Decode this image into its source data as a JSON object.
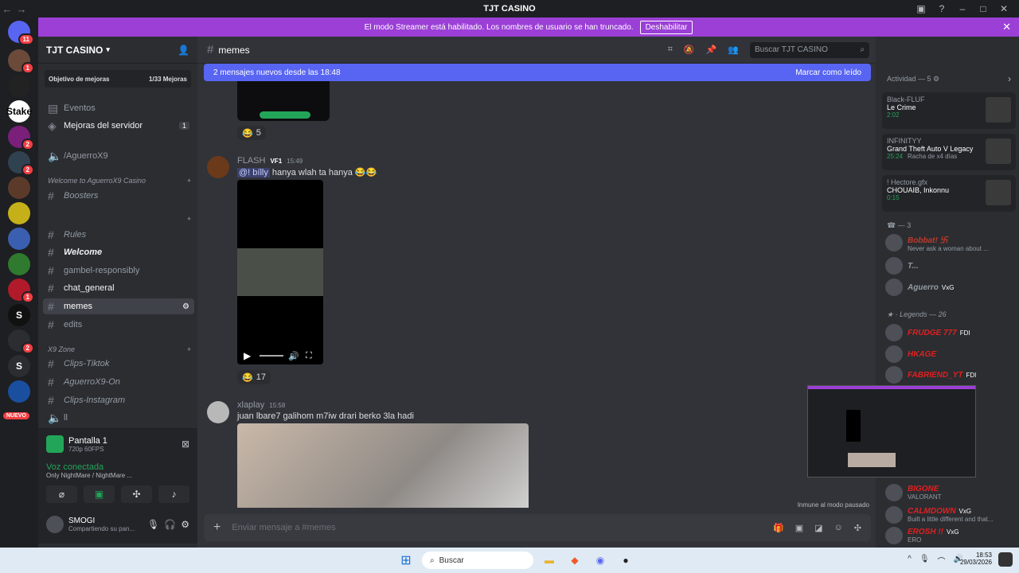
{
  "titlebar": {
    "title": "TJT CASINO"
  },
  "banner": {
    "text": "El modo Streamer está habilitado. Los nombres de usuario se han truncado.",
    "button": "Deshabilitar"
  },
  "guilds": [
    {
      "label": "",
      "badge": "11",
      "color": "#5865f2"
    },
    {
      "label": "",
      "badge": "1",
      "color": "#6b4a3a"
    },
    {
      "label": "",
      "badge": "",
      "color": "#222"
    },
    {
      "label": "Stake",
      "badge": "",
      "color": "#fff"
    },
    {
      "label": "",
      "badge": "2",
      "color": "#7a1f7a"
    },
    {
      "label": "",
      "badge": "2",
      "color": "#30414f"
    },
    {
      "label": "",
      "badge": "",
      "color": "#5b3a2a"
    },
    {
      "label": "",
      "badge": "",
      "color": "#c5b01a"
    },
    {
      "label": "",
      "badge": "",
      "color": "#3a5fb0"
    },
    {
      "label": "",
      "badge": "",
      "color": "#2f7a2f"
    },
    {
      "label": "",
      "badge": "1",
      "color": "#b01a2a"
    },
    {
      "label": "S",
      "badge": "",
      "color": "#111"
    },
    {
      "label": "",
      "badge": "2",
      "color": "#2b2d31"
    },
    {
      "label": "S",
      "badge": "",
      "color": "#2b2d31"
    },
    {
      "label": "",
      "badge": "",
      "color": "#1a4fa0"
    }
  ],
  "guild_new_label": "NUEVO",
  "server": {
    "name": "TJT CASINO",
    "boost_label": "Objetivo de mejoras",
    "boost_progress": "1/33 Mejoras"
  },
  "sidebar": {
    "events": "Eventos",
    "server_boosts": "Mejoras del servidor",
    "server_boosts_count": "1",
    "voice1": "/AguerroX9",
    "cat1": "Welcome to AguerroX9 Casino",
    "boosters": "Boosters",
    "cat2": "",
    "rules": "Rules",
    "welcome": "Welcome",
    "gambel": "gambel-responsibly",
    "chat_general": "chat_general",
    "memes": "memes",
    "edits": "edits",
    "cat3": "X9 Zone",
    "tiktok": "Clips-Tiktok",
    "aguerro_on": "AguerroX9-On",
    "instagram": "Clips-Instagram",
    "voice2": "ll"
  },
  "stream": {
    "title": "Pantalla 1",
    "quality": "720p 60FPS"
  },
  "voice": {
    "status": "Voz conectada",
    "channel": "Only NightMare",
    "sub": "/ NightMare ..."
  },
  "user": {
    "name": "SMOGI",
    "status": "Compartiendo su pan..."
  },
  "chat": {
    "channel": "memes",
    "new_messages": "2 mensajes nuevos desde las 18:48",
    "mark_read": "Marcar como leído",
    "reaction1": "5",
    "msg1_author": "FLASH",
    "msg1_tag": "VF1",
    "msg1_time": "15:49",
    "msg1_mention": "@! bílly",
    "msg1_text": "hanya wlah ta hanya",
    "reaction2": "17",
    "msg2_author": "xlaplay",
    "msg2_time": "15:58",
    "msg2_text": "juan lbare7 galihom m7iw drari berko 3la hadi",
    "paused": "Inmune al modo pausado",
    "input_placeholder": "Enviar mensaje a #memes",
    "search_placeholder": "Buscar TJT CASINO"
  },
  "members": {
    "activity_header": "Actividad — 5",
    "cards": [
      {
        "name": "Black-FLUF",
        "activity": "Le Crime",
        "sub": "2:02"
      },
      {
        "name": "INFINITYY",
        "activity": "Grand Theft Auto V Legacy",
        "sub": "25:24",
        "extra": "Racha de x4 días"
      },
      {
        "name": "! Hectore.gfx",
        "activity": "CHOUAIB, Inkonnu",
        "sub": "0:15"
      }
    ],
    "group1": "3",
    "g1": [
      {
        "name": "Bobbat! 卐",
        "status": "Never ask a woman about ..."
      },
      {
        "name": "T...",
        "status": ""
      },
      {
        "name": "Aguerro",
        "status": "",
        "tag": "VxG"
      }
    ],
    "group2": "Legends — 26",
    "g2": [
      {
        "name": "FRUDGE 777",
        "tag": "FDI"
      },
      {
        "name": "HKAGE",
        "tag": ""
      },
      {
        "name": "FABRIEND_YT",
        "tag": "FDI"
      },
      {
        "name": "BIGONE",
        "status": "VALORANT"
      },
      {
        "name": "CALMDOWN",
        "tag": "VxG",
        "status": "Built a little different and that..."
      },
      {
        "name": "EROSH !!",
        "tag": "VxG",
        "status": "ERO"
      }
    ]
  },
  "taskbar": {
    "search": "Buscar",
    "time": "18:53",
    "date": "29/03/2026"
  }
}
